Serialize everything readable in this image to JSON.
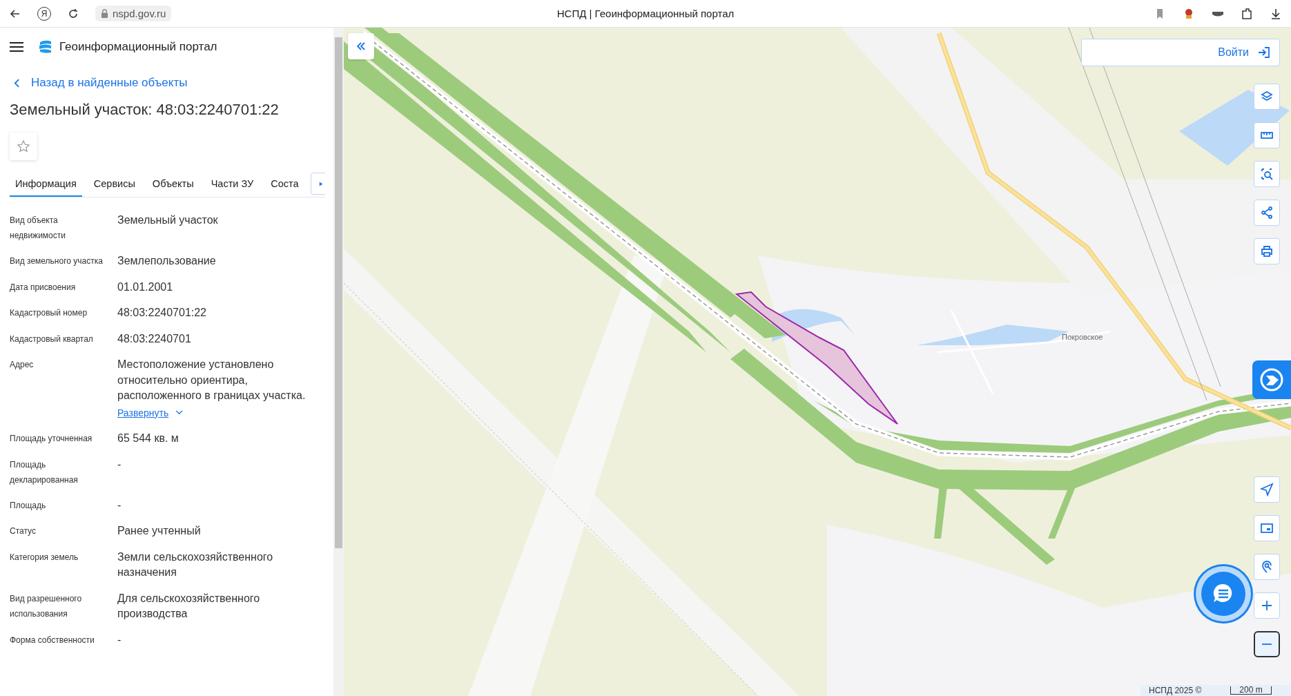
{
  "browser": {
    "logo_letter": "Я",
    "url": "nspd.gov.ru",
    "title": "НСПД | Геоинформационный портал"
  },
  "header": {
    "title": "Геоинформационный портал"
  },
  "back_link": "Назад в найденные объекты",
  "object_title": "Земельный участок: 48:03:2240701:22",
  "tabs": [
    {
      "label": "Информация",
      "selected": true
    },
    {
      "label": "Сервисы",
      "selected": false
    },
    {
      "label": "Объекты",
      "selected": false
    },
    {
      "label": "Части ЗУ",
      "selected": false
    },
    {
      "label": "Соста",
      "selected": false
    }
  ],
  "fields": [
    {
      "label": "Вид объекта недвижимости",
      "value": "Земельный участок"
    },
    {
      "label": "Вид земельного участка",
      "value": "Землепользование"
    },
    {
      "label": "Дата присвоения",
      "value": "01.01.2001"
    },
    {
      "label": "Кадастровый номер",
      "value": "48:03:2240701:22"
    },
    {
      "label": "Кадастровый квартал",
      "value": "48:03:2240701"
    },
    {
      "label": "Адрес",
      "value": "Местоположение установлено относительно ориентира, расположенного в границах участка.",
      "link": "Развернуть"
    },
    {
      "label": "Площадь уточненная",
      "value": "65 544 кв. м"
    },
    {
      "label": "Площадь декларированная",
      "value": "-"
    },
    {
      "label": "Площадь",
      "value": "-"
    },
    {
      "label": "Статус",
      "value": "Ранее учтенный"
    },
    {
      "label": "Категория земель",
      "value": "Земли сельскохозяйственного назначения"
    },
    {
      "label": "Вид разрешенного использования",
      "value": "Для сельскохозяйственного производства"
    },
    {
      "label": "Форма собственности",
      "value": "-"
    }
  ],
  "map": {
    "login": "Войти",
    "place_label": "Покровское",
    "attribution": "НСПД 2025 ©",
    "scale": "200 m",
    "tools": [
      {
        "kind": "layers"
      },
      {
        "kind": "ruler"
      },
      {
        "kind": "area-search"
      },
      {
        "kind": "share"
      },
      {
        "kind": "print"
      }
    ],
    "controls": [
      {
        "kind": "navigate",
        "focused": false
      },
      {
        "kind": "minimap",
        "focused": false
      },
      {
        "kind": "location-search",
        "focused": false
      },
      {
        "kind": "zoom-in",
        "focused": false
      },
      {
        "kind": "zoom-out",
        "focused": true
      }
    ]
  }
}
